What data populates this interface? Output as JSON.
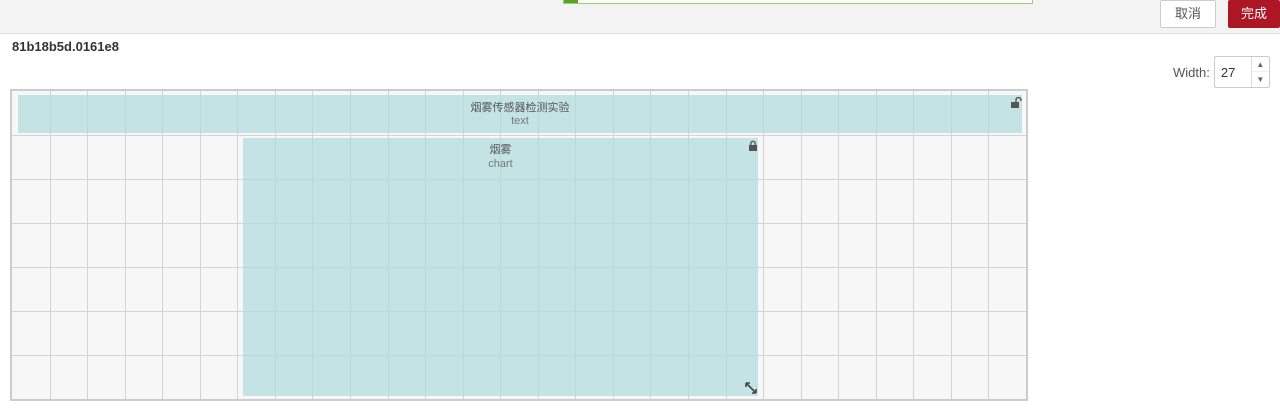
{
  "toolbar": {
    "progress_percent": 3,
    "cancel_label": "取消",
    "done_label": "完成",
    "accent_color": "#ad1625"
  },
  "node": {
    "id": "81b18b5d.0161e8"
  },
  "width_control": {
    "label": "Width:",
    "value": "27"
  },
  "grid": {
    "columns": 27,
    "rows": 6
  },
  "widgets": {
    "text": {
      "title": "烟雾传感器检测实验",
      "type": "text",
      "lock": "unlocked"
    },
    "chart": {
      "title": "烟雾",
      "type": "chart",
      "lock": "locked"
    }
  },
  "icons": {
    "text_lock": "unlock-icon",
    "chart_lock": "lock-icon",
    "chart_resize": "resize-handle-icon",
    "spin_up": "chevron-up-icon",
    "spin_down": "chevron-down-icon"
  }
}
